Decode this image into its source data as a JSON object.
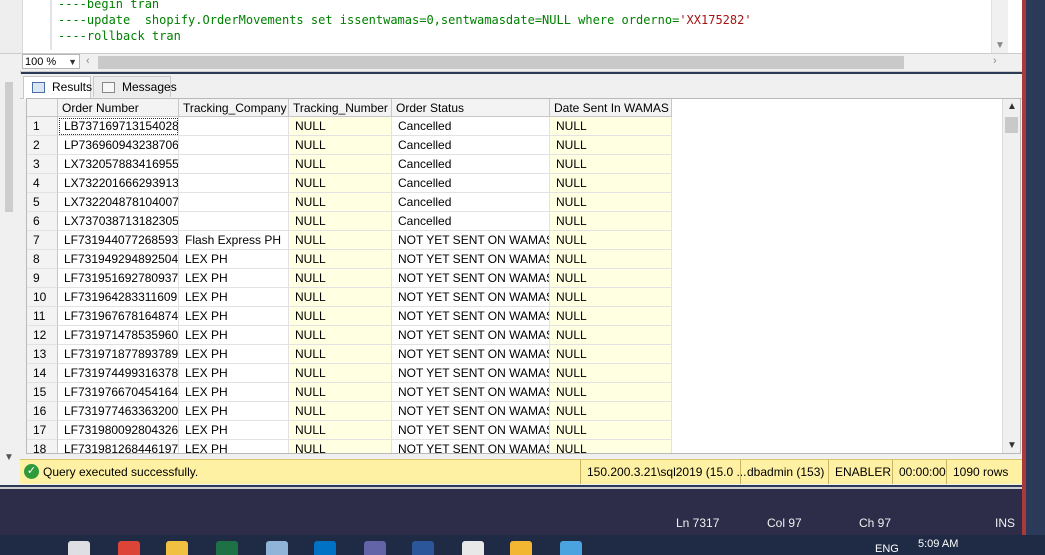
{
  "editor": {
    "lines": [
      {
        "comment": "----begin tran",
        "code": "",
        "string": "",
        "end": ""
      },
      {
        "comment": "----update",
        "code": "  shopify.OrderMovements set issentwamas=0,sentwamasdate=NULL where orderno=",
        "string": "'XX175282'",
        "end": ""
      },
      {
        "comment": "----rollback tran",
        "code": "",
        "string": "",
        "end": ""
      }
    ]
  },
  "zoom": {
    "value": "100 %"
  },
  "tabs": [
    {
      "label": "Results",
      "icon": "grid-icon"
    },
    {
      "label": "Messages",
      "icon": "messages-icon"
    }
  ],
  "grid": {
    "columns": [
      "Order Number",
      "Tracking_Company",
      "Tracking_Number",
      "Order Status",
      "Date Sent In WAMAS"
    ],
    "rows": [
      [
        "1",
        "LB737169713154028",
        "",
        "NULL",
        "Cancelled",
        "NULL"
      ],
      [
        "2",
        "LP736960943238706",
        "",
        "NULL",
        "Cancelled",
        "NULL"
      ],
      [
        "3",
        "LX732057883416955",
        "",
        "NULL",
        "Cancelled",
        "NULL"
      ],
      [
        "4",
        "LX732201666293913",
        "",
        "NULL",
        "Cancelled",
        "NULL"
      ],
      [
        "5",
        "LX732204878104007",
        "",
        "NULL",
        "Cancelled",
        "NULL"
      ],
      [
        "6",
        "LX737038713182305",
        "",
        "NULL",
        "Cancelled",
        "NULL"
      ],
      [
        "7",
        "LF731944077268593",
        "Flash Express PH",
        "NULL",
        "NOT YET SENT ON WAMAS",
        "NULL"
      ],
      [
        "8",
        "LF731949294892504",
        "LEX PH",
        "NULL",
        "NOT YET SENT ON WAMAS",
        "NULL"
      ],
      [
        "9",
        "LF731951692780937",
        "LEX PH",
        "NULL",
        "NOT YET SENT ON WAMAS",
        "NULL"
      ],
      [
        "10",
        "LF731964283311609",
        "LEX PH",
        "NULL",
        "NOT YET SENT ON WAMAS",
        "NULL"
      ],
      [
        "11",
        "LF731967678164874",
        "LEX PH",
        "NULL",
        "NOT YET SENT ON WAMAS",
        "NULL"
      ],
      [
        "12",
        "LF731971478535960",
        "LEX PH",
        "NULL",
        "NOT YET SENT ON WAMAS",
        "NULL"
      ],
      [
        "13",
        "LF731971877893789",
        "LEX PH",
        "NULL",
        "NOT YET SENT ON WAMAS",
        "NULL"
      ],
      [
        "14",
        "LF731974499316378",
        "LEX PH",
        "NULL",
        "NOT YET SENT ON WAMAS",
        "NULL"
      ],
      [
        "15",
        "LF731976670454164",
        "LEX PH",
        "NULL",
        "NOT YET SENT ON WAMAS",
        "NULL"
      ],
      [
        "16",
        "LF731977463363200",
        "LEX PH",
        "NULL",
        "NOT YET SENT ON WAMAS",
        "NULL"
      ],
      [
        "17",
        "LF731980092804326",
        "LEX PH",
        "NULL",
        "NOT YET SENT ON WAMAS",
        "NULL"
      ],
      [
        "18",
        "LF731981268446197",
        "LEX PH",
        "NULL",
        "NOT YET SENT ON WAMAS",
        "NULL"
      ]
    ]
  },
  "status": {
    "message": "Query executed successfully.",
    "server": "150.200.3.21\\sql2019 (15.0 ...",
    "user": "dbadmin (153)",
    "database": "ENABLER",
    "elapsed": "00:00:00",
    "rows": "1090 rows"
  },
  "editor_status": {
    "ln": "Ln 7317",
    "col": "Col 97",
    "ch": "Ch 97",
    "mode": "INS"
  },
  "taskbar": {
    "apps": [
      "task-view-icon",
      "chrome-icon",
      "file-explorer-icon",
      "excel-icon",
      "notepad-icon",
      "outlook-icon",
      "teams-icon",
      "word-icon",
      "app-icon",
      "folder-icon",
      "remote-icon"
    ],
    "language": "ENG",
    "time": "5:09 AM"
  },
  "colors": {
    "null_cell": "#ffffe1",
    "status_bar": "#fff1a3",
    "comment": "#008000",
    "string": "#a31515"
  }
}
